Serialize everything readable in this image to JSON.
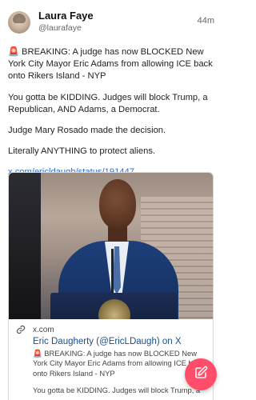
{
  "author": {
    "display_name": "Laura Faye",
    "handle": "@laurafaye",
    "time": "44m"
  },
  "post": {
    "paragraph_1": "🚨 BREAKING: A judge has now BLOCKED New York City Mayor Eric Adams from allowing ICE back onto Rikers Island - NYP",
    "paragraph_2": "You gotta be KIDDING. Judges will block Trump, a Republican, AND Adams, a Democrat.",
    "paragraph_3": "Judge Mary Rosado made the decision.",
    "paragraph_4": "Literally ANYTHING to protect aliens.",
    "link": "x.com/ericldaugh/status/191447..."
  },
  "link_card": {
    "domain": "x.com",
    "title": "Eric Daugherty (@EricLDaugh) on X",
    "desc_1": "🚨 BREAKING: A judge has now BLOCKED New York City Mayor Eric Adams from allowing ICE back onto Rikers Island - NYP",
    "desc_2": "You gotta be KIDDING. Judges will block Trump, a"
  },
  "icons": {
    "link": "link-icon",
    "compose": "compose-icon"
  },
  "colors": {
    "link": "#2b6dc9",
    "fab": "#ff4d6a"
  }
}
